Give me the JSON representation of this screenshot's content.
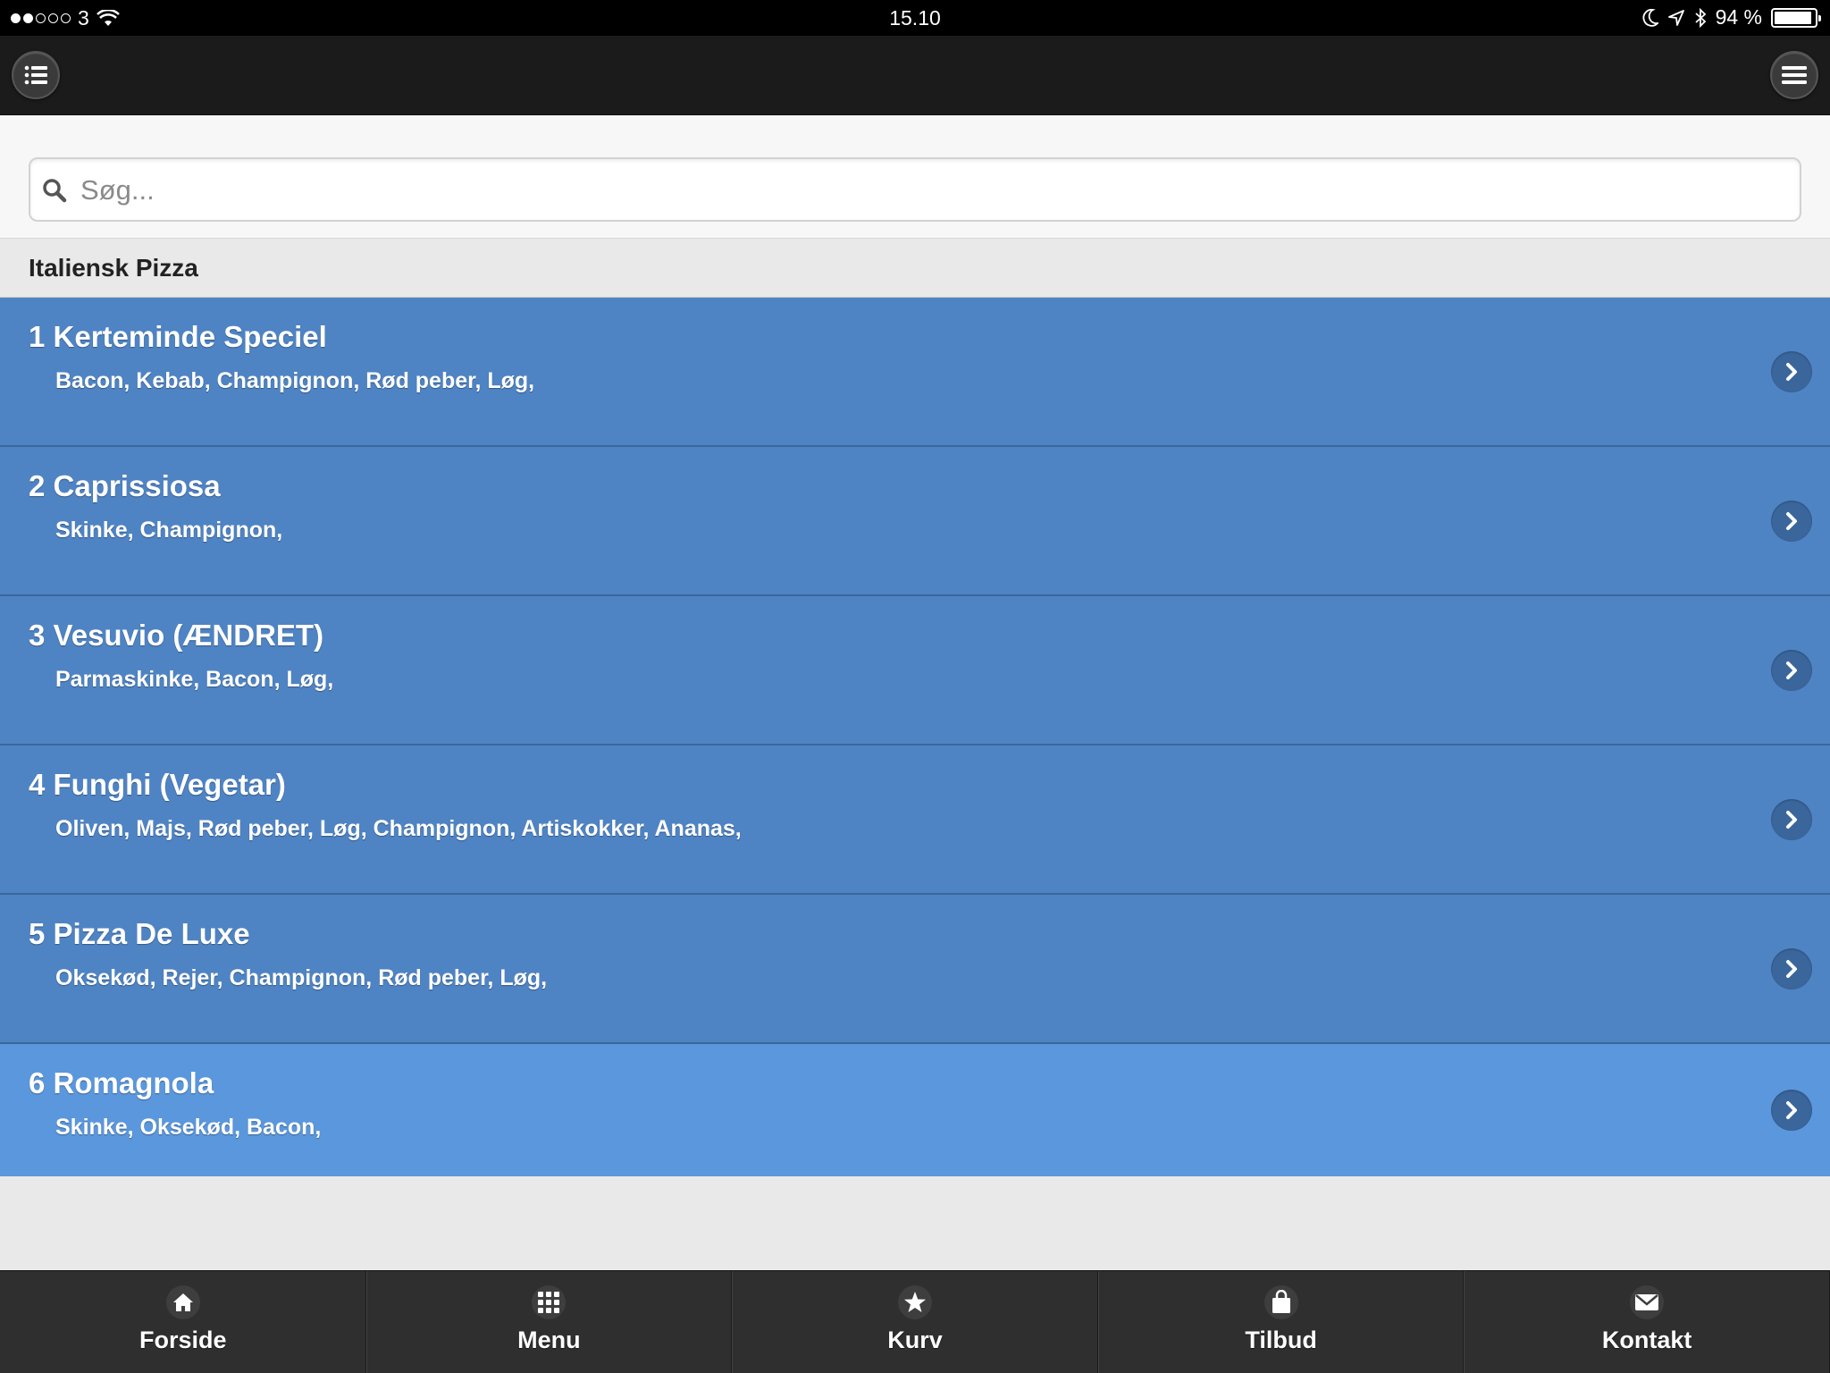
{
  "status_bar": {
    "carrier": "3",
    "time": "15.10",
    "battery": "94 %",
    "battery_level": 0.94
  },
  "header": {
    "left_button": "list-icon",
    "right_button": "hamburger-menu-icon"
  },
  "search": {
    "placeholder": "Søg...",
    "value": ""
  },
  "category": {
    "title": "Italiensk Pizza"
  },
  "items": [
    {
      "title": "1 Kerteminde Speciel",
      "desc": "Bacon, Kebab, Champignon, Rød peber, Løg,"
    },
    {
      "title": "2 Caprissiosa",
      "desc": "Skinke, Champignon,"
    },
    {
      "title": "3 Vesuvio (ÆNDRET)",
      "desc": "Parmaskinke, Bacon, Løg,"
    },
    {
      "title": "4 Funghi (Vegetar)",
      "desc": "Oliven, Majs, Rød peber, Løg, Champignon, Artiskokker, Ananas,"
    },
    {
      "title": "5 Pizza De Luxe",
      "desc": "Oksekød, Rejer, Champignon, Rød peber, Løg,"
    },
    {
      "title": "6 Romagnola",
      "desc": "Skinke, Oksekød, Bacon,"
    }
  ],
  "colors": {
    "item_bg": "#4f84c4",
    "item_active_bg": "#5b97dc",
    "header_bg": "#1b1b1b",
    "nav_bg": "#2f2f2f"
  },
  "nav": [
    {
      "label": "Forside",
      "icon": "home-icon"
    },
    {
      "label": "Menu",
      "icon": "grid-icon"
    },
    {
      "label": "Kurv",
      "icon": "star-icon"
    },
    {
      "label": "Tilbud",
      "icon": "shopping-bag-icon"
    },
    {
      "label": "Kontakt",
      "icon": "envelope-icon"
    }
  ]
}
